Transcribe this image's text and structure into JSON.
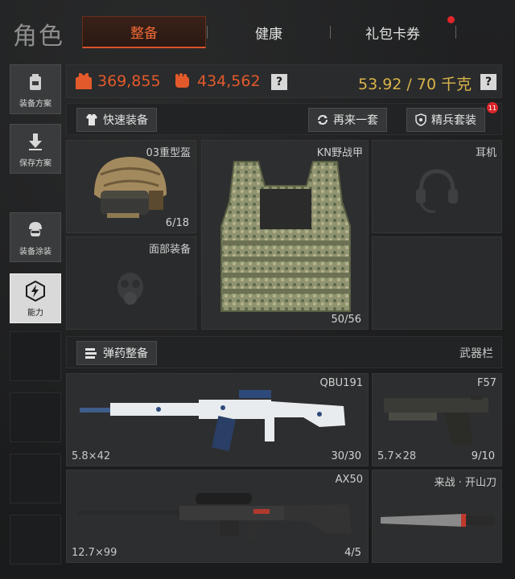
{
  "header": {
    "title": "角色",
    "tabs": [
      {
        "label": "整备",
        "active": true
      },
      {
        "label": "健康",
        "active": false
      },
      {
        "label": "礼包卡券",
        "active": false,
        "has_notification": true
      }
    ]
  },
  "sidebar": {
    "items": [
      {
        "label": "装备方案",
        "icon": "backpack-icon"
      },
      {
        "label": "保存方案",
        "icon": "download-icon"
      },
      {
        "label": "装备涂装",
        "icon": "soldier-icon"
      },
      {
        "label": "能力",
        "icon": "lightning-icon",
        "active": true
      }
    ]
  },
  "stats": {
    "armor_value": "369,855",
    "fist_value": "434,562",
    "weight": "53.92 / 70 千克",
    "help": "?"
  },
  "actions": {
    "quick_equip": "快速装备",
    "again": "再来一套",
    "elite_set": "精兵套装",
    "elite_badge": "11"
  },
  "gear": {
    "helmet": {
      "name": "03重型盔",
      "count": "6/18"
    },
    "armor": {
      "name": "KN野战甲",
      "count": "50/56"
    },
    "headset": {
      "name": "耳机"
    },
    "face": {
      "name": "面部装备"
    }
  },
  "ammo_row": {
    "ammo_button": "弹药整备",
    "weapon_bar": "武器栏"
  },
  "weapons": [
    {
      "name": "QBU191",
      "caliber": "5.8×42",
      "ammo": "30/30"
    },
    {
      "name": "F57",
      "caliber": "5.7×28",
      "ammo": "9/10"
    },
    {
      "name": "AX50",
      "caliber": "12.7×99",
      "ammo": "4/5"
    },
    {
      "name": "来战 · 开山刀",
      "caliber": "",
      "ammo": ""
    }
  ],
  "colors": {
    "accent": "#e25a2b",
    "weight": "#d9b44a",
    "badge": "#d7262b"
  }
}
